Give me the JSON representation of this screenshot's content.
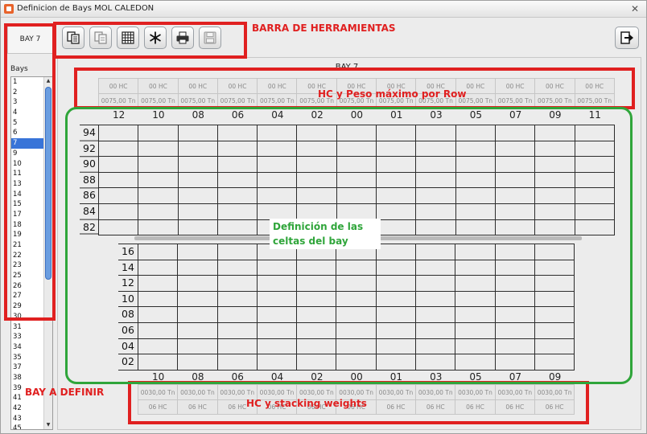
{
  "window": {
    "title": "Definicion de Bays MOL CALEDON",
    "close_glyph": "✕"
  },
  "annotations": {
    "toolbar": "BARRA DE HERRAMIENTAS",
    "hc_weight_row": "HC y Peso máximo por Row",
    "bay_define": "BAY A DEFINIR",
    "cells": "Definición de las celtas del bay",
    "stacking": "HC y stacking weights"
  },
  "left_panel": {
    "bay_label": "BAY 7",
    "bays_header": "Bays",
    "bays": [
      "1",
      "2",
      "3",
      "4",
      "5",
      "6",
      "7",
      "9",
      "10",
      "11",
      "13",
      "14",
      "15",
      "17",
      "18",
      "19",
      "21",
      "22",
      "23",
      "25",
      "26",
      "27",
      "29",
      "30",
      "31",
      "33",
      "34",
      "35",
      "37",
      "38",
      "39",
      "41",
      "42",
      "43",
      "45"
    ],
    "selected": "7"
  },
  "toolbar": {
    "buttons": [
      {
        "name": "copy-icon"
      },
      {
        "name": "paste-icon"
      },
      {
        "name": "grid-icon"
      },
      {
        "name": "snowflake-icon"
      },
      {
        "name": "printer-icon"
      },
      {
        "name": "save-icon"
      }
    ],
    "exit": {
      "name": "exit-icon"
    }
  },
  "bay_view": {
    "title": "BAY 7",
    "top_rows": [
      "12",
      "10",
      "08",
      "06",
      "04",
      "02",
      "00",
      "01",
      "03",
      "05",
      "07",
      "09",
      "11"
    ],
    "top_hc": [
      "00 HC",
      "00 HC",
      "00 HC",
      "00 HC",
      "00 HC",
      "00 HC",
      "00 HC",
      "00 HC",
      "00 HC",
      "00 HC",
      "00 HC",
      "00 HC",
      "00 HC"
    ],
    "top_weight": [
      "0075,00 Tn",
      "0075,00 Tn",
      "0075,00 Tn",
      "0075,00 Tn",
      "0075,00 Tn",
      "0075,00 Tn",
      "0075,00 Tn",
      "0075,00 Tn",
      "0075,00 Tn",
      "0075,00 Tn",
      "0075,00 Tn",
      "0075,00 Tn",
      "0075,00 Tn"
    ],
    "deck_tiers": [
      "94",
      "92",
      "90",
      "88",
      "86",
      "84",
      "82"
    ],
    "hold_tiers": [
      "16",
      "14",
      "12",
      "10",
      "08",
      "06",
      "04",
      "02"
    ],
    "bottom_rows": [
      "10",
      "08",
      "06",
      "04",
      "02",
      "00",
      "01",
      "03",
      "05",
      "07",
      "09"
    ],
    "bottom_weight": [
      "0030,00 Tn",
      "0030,00 Tn",
      "0030,00 Tn",
      "0030,00 Tn",
      "0030,00 Tn",
      "0030,00 Tn",
      "0030,00 Tn",
      "0030,00 Tn",
      "0030,00 Tn",
      "0030,00 Tn",
      "0030,00 Tn"
    ],
    "bottom_hc": [
      "06 HC",
      "06 HC",
      "06 HC",
      "06 HC",
      "06 HC",
      "06 HC",
      "06 HC",
      "06 HC",
      "06 HC",
      "06 HC",
      "06 HC"
    ]
  }
}
